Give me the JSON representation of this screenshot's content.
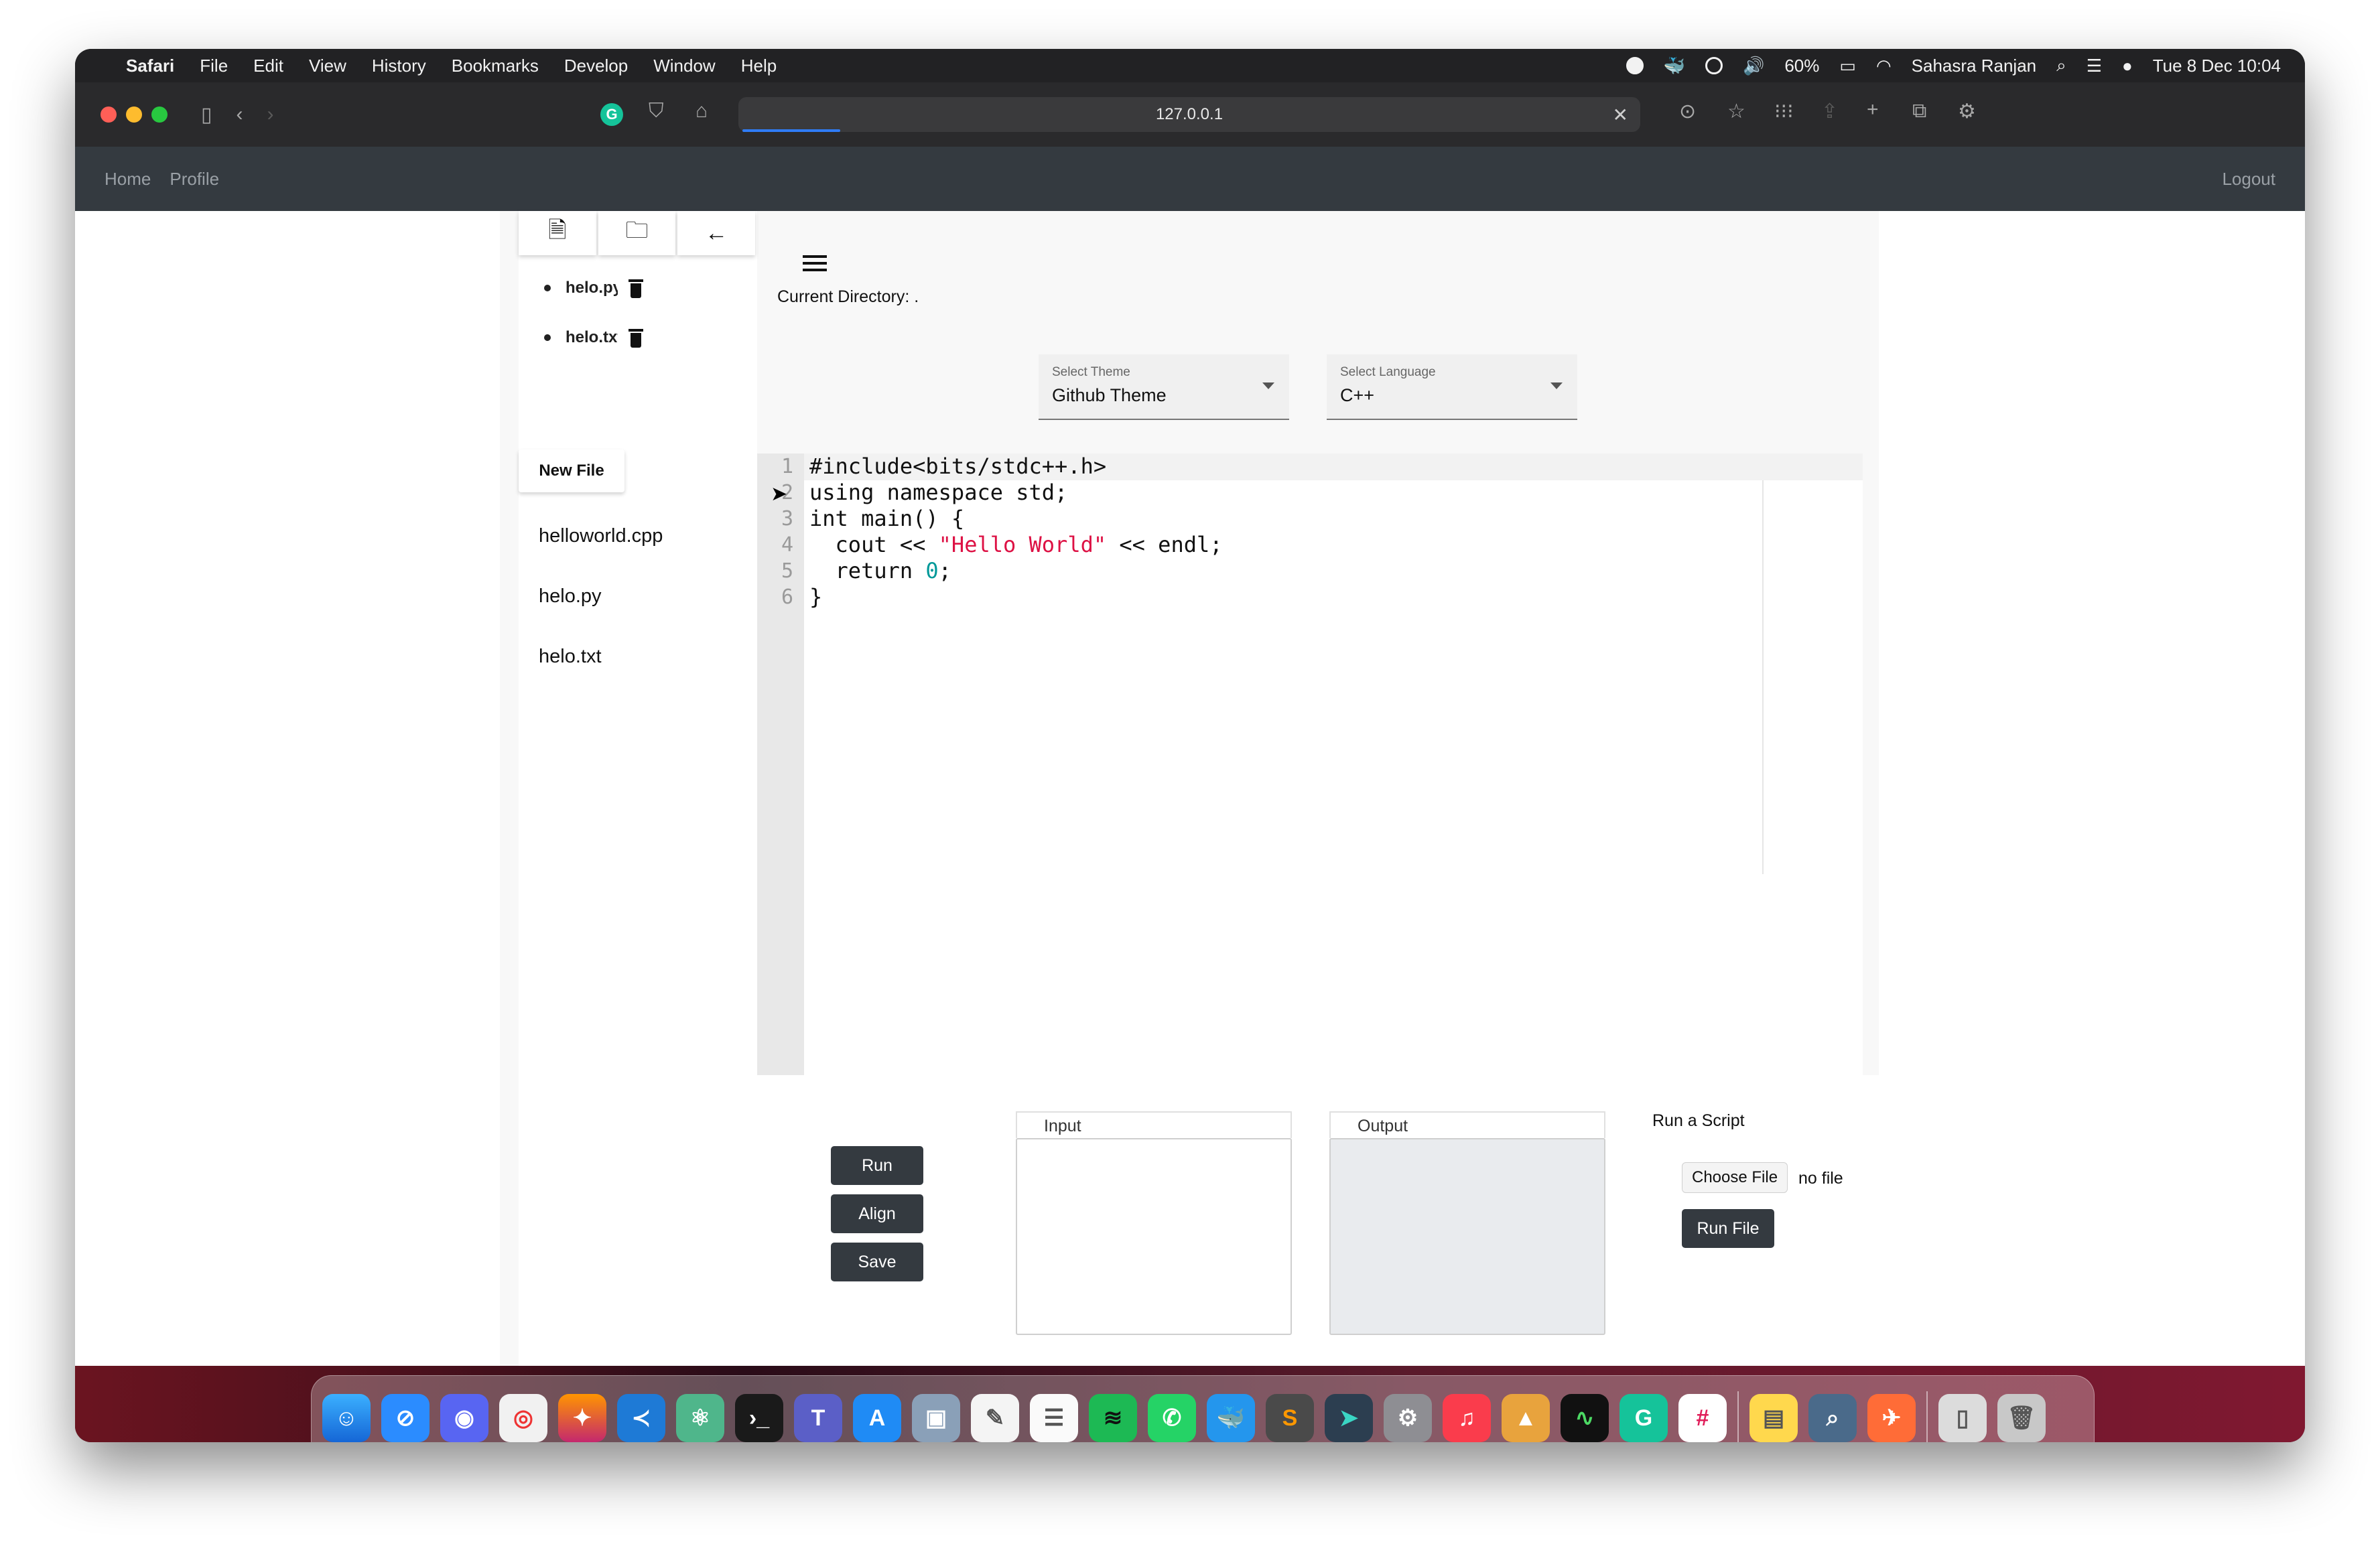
{
  "menubar": {
    "app": "Safari",
    "items": [
      "File",
      "Edit",
      "View",
      "History",
      "Bookmarks",
      "Develop",
      "Window",
      "Help"
    ],
    "battery": "60%",
    "user": "Sahasra Ranjan",
    "datetime": "Tue 8 Dec  10:04"
  },
  "browser": {
    "url": "127.0.0.1"
  },
  "navbar": {
    "home": "Home",
    "profile": "Profile",
    "logout": "Logout"
  },
  "sidebar": {
    "tree": [
      {
        "name": "helo.py"
      },
      {
        "name": "helo.txt"
      }
    ],
    "new_file_label": "New File",
    "files": [
      "helloworld.cpp",
      "helo.py",
      "helo.txt"
    ]
  },
  "main": {
    "current_directory": "Current Directory: .",
    "theme_select": {
      "label": "Select Theme",
      "value": "Github Theme"
    },
    "language_select": {
      "label": "Select Language",
      "value": "C++"
    }
  },
  "editor": {
    "lines": [
      {
        "n": "1",
        "text": "#include<bits/stdc++.h>"
      },
      {
        "n": "2",
        "text": "using namespace std;"
      },
      {
        "n": "3",
        "text": "int main() {"
      },
      {
        "n": "4",
        "text": "  cout << ",
        "str": "\"Hello World\"",
        "rest": " << endl;"
      },
      {
        "n": "5",
        "text": "  return ",
        "num": "0",
        "rest": ";"
      },
      {
        "n": "6",
        "text": "}"
      }
    ]
  },
  "actions": {
    "run": "Run",
    "align": "Align",
    "save": "Save",
    "input_label": "Input",
    "output_label": "Output",
    "script_title": "Run a Script",
    "choose_file": "Choose File",
    "no_file": "no file",
    "run_file": "Run File"
  },
  "dock": {
    "apps": [
      "Finder",
      "Safari",
      "Discord",
      "Chrome",
      "Firefox",
      "VS Code",
      "Atom",
      "Terminal",
      "Teams",
      "App Store",
      "Preview",
      "TextEdit",
      "Reminders",
      "Spotify",
      "WhatsApp",
      "Docker",
      "Sublime",
      "Prompt",
      "Settings",
      "Music",
      "MATLAB",
      "Activity Monitor",
      "Grammarly",
      "Slack",
      "Notes",
      "Finder Search",
      "Postman",
      "Files",
      "Trash"
    ]
  }
}
